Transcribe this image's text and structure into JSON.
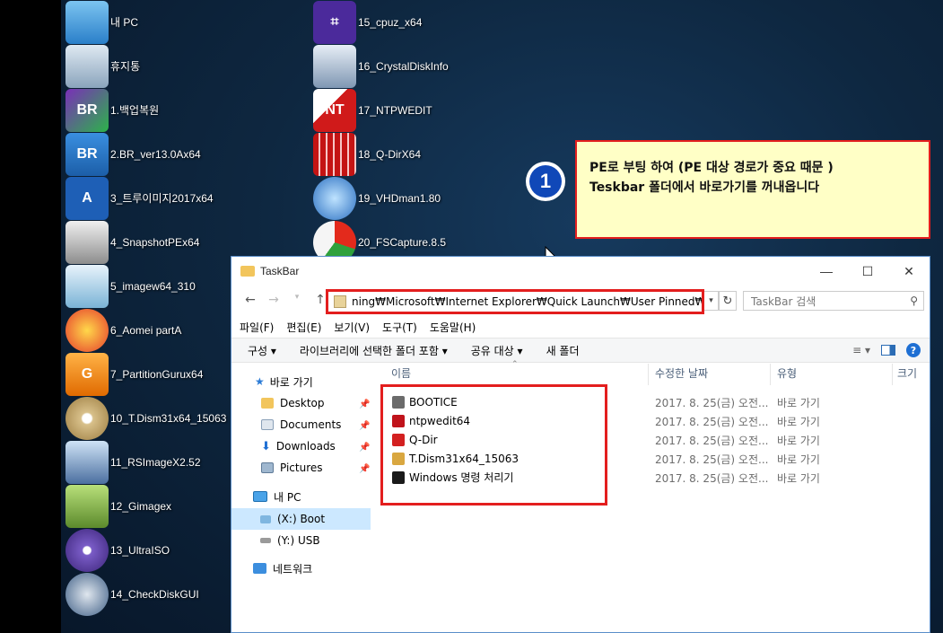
{
  "desktop_icons_col1": [
    {
      "label": "내 PC",
      "icon": "this-pc-icon"
    },
    {
      "label": "휴지통",
      "icon": "recycle-bin-icon"
    },
    {
      "label": "1.백업복원",
      "icon": "br-backup-icon"
    },
    {
      "label": "2.BR_ver13.0Ax64",
      "icon": "br-app-icon"
    },
    {
      "label": "3_트루이미지2017x64",
      "icon": "acronis-icon"
    },
    {
      "label": "4_SnapshotPEx64",
      "icon": "snapshot-drive-icon"
    },
    {
      "label": "5_imagew64_310",
      "icon": "imagew-pc-icon"
    },
    {
      "label": "6_Aomei partA",
      "icon": "aomei-icon"
    },
    {
      "label": "7_PartitionGurux64",
      "icon": "partitionguru-icon"
    },
    {
      "label": "10_T.Dism31x64_15063",
      "icon": "dism-disc-icon"
    },
    {
      "label": "11_RSImageX2.52",
      "icon": "rsimagex-icon"
    },
    {
      "label": "12_Gimagex",
      "icon": "gimagex-icon"
    },
    {
      "label": "13_UltraISO",
      "icon": "ultraiso-icon"
    },
    {
      "label": "14_CheckDiskGUI",
      "icon": "checkdisk-icon"
    }
  ],
  "desktop_icons_col2": [
    {
      "label": "15_cpuz_x64",
      "icon": "cpuz-icon"
    },
    {
      "label": "16_CrystalDiskInfo",
      "icon": "crystaldiskinfo-icon"
    },
    {
      "label": "17_NTPWEDIT",
      "icon": "ntpwedit-key-icon"
    },
    {
      "label": "18_Q-DirX64",
      "icon": "qdir-icon"
    },
    {
      "label": "19_VHDman1.80",
      "icon": "vhdman-icon"
    },
    {
      "label": "20_FSCapture.8.5",
      "icon": "fscapture-icon"
    }
  ],
  "annotation": {
    "number": "1",
    "line1": "PE로 부팅 하여  (PE 대상 경로가 중요 때문 )",
    "line2": "Teskbar 폴더에서 바로가기를  꺼내옵니다"
  },
  "explorer": {
    "title": "TaskBar",
    "address": "ning₩Microsoft₩Internet Explorer₩Quick Launch₩User Pinned₩TaskBar",
    "search_placeholder": "TaskBar 검색",
    "menu": [
      "파일(F)",
      "편집(E)",
      "보기(V)",
      "도구(T)",
      "도움말(H)"
    ],
    "commands": [
      "구성 ▾",
      "라이브러리에 선택한 폴더 포함 ▾",
      "공유 대상 ▾",
      "새 폴더"
    ],
    "nav": {
      "quick_access": "바로 가기",
      "desktop": "Desktop",
      "documents": "Documents",
      "downloads": "Downloads",
      "pictures": "Pictures",
      "this_pc": "내 PC",
      "drive_x": "(X:) Boot",
      "drive_y": "(Y:) USB",
      "network": "네트워크"
    },
    "columns": {
      "name": "이름",
      "date": "수정한 날짜",
      "type": "유형",
      "size": "크기"
    },
    "files": [
      {
        "name": "BOOTICE",
        "date": "2017. 8. 25(금) 오전...",
        "type": "바로 가기",
        "icon": "bootice-icon",
        "color": "#6b6b6b"
      },
      {
        "name": "ntpwedit64",
        "date": "2017. 8. 25(금) 오전...",
        "type": "바로 가기",
        "icon": "ntpwedit-icon",
        "color": "#c0131b"
      },
      {
        "name": "Q-Dir",
        "date": "2017. 8. 25(금) 오전...",
        "type": "바로 가기",
        "icon": "qdir-icon",
        "color": "#d32020"
      },
      {
        "name": "T.Dism31x64_15063",
        "date": "2017. 8. 25(금) 오전...",
        "type": "바로 가기",
        "icon": "dism-icon",
        "color": "#d9a740"
      },
      {
        "name": "Windows 명령 처리기",
        "date": "2017. 8. 25(금) 오전...",
        "type": "바로 가기",
        "icon": "cmd-icon",
        "color": "#1a1a1a"
      }
    ]
  }
}
